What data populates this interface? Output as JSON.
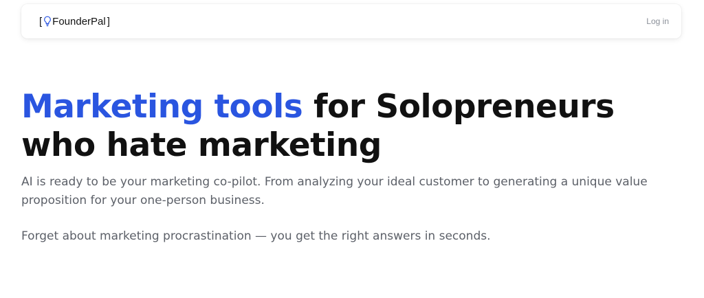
{
  "nav": {
    "logo": {
      "bracket_open": "[",
      "icon": "lightbulb-icon",
      "brand": "FounderPal",
      "bracket_close": "]"
    },
    "login_label": "Log in"
  },
  "hero": {
    "headline_accent": "Marketing tools",
    "headline_rest": " for Solopreneurs who hate marketing",
    "subtitle": "AI is ready to be your marketing co-pilot. From analyzing your ideal customer to generating a unique value proposition for your one-person business.",
    "tagline": "Forget about marketing procrastination — you get the right answers in seconds."
  },
  "colors": {
    "accent": "#2a55e0",
    "text": "#111111",
    "muted": "#5c6068"
  }
}
